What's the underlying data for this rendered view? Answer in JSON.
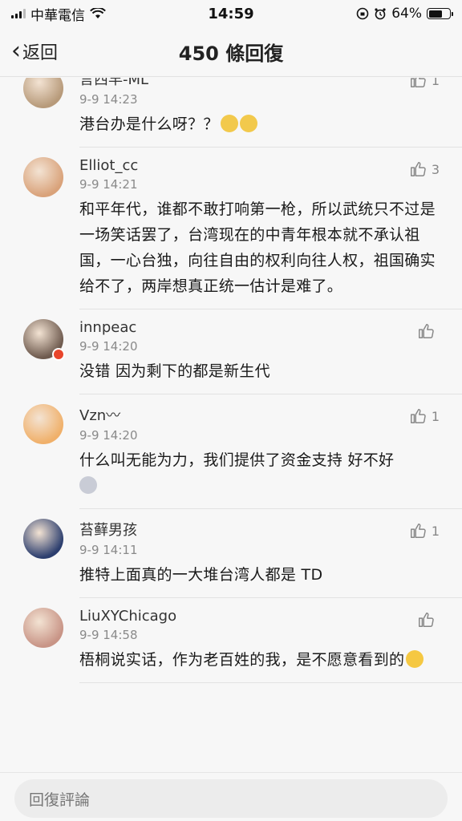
{
  "status_bar": {
    "carrier": "中華電信",
    "time": "14:59",
    "battery": "64%",
    "battery_level": 0.64
  },
  "nav": {
    "back_label": "返回",
    "title": "450 條回復"
  },
  "comments": [
    {
      "name": "言西早-ML",
      "time": "9-9 14:23",
      "text": "港台办是什么呀？？",
      "likes": "1",
      "avatar_color": "#b79a7a",
      "emoji_color": "#f2c94c"
    },
    {
      "name": "Elliot_cc",
      "time": "9-9 14:21",
      "text": "和平年代，谁都不敢打响第一枪，所以武统只不过是一场笑话罢了，台湾现在的中青年根本就不承认祖国，一心台独，向往自由的权利向往人权，祖国确实给不了，两岸想真正统一估计是难了。",
      "likes": "3",
      "avatar_color": "#d9a27a"
    },
    {
      "name": "innpeac",
      "time": "9-9 14:20",
      "text": "没错 因为剩下的都是新生代",
      "likes": "",
      "avatar_color": "#6e5a4e"
    },
    {
      "name": "Vzn〰",
      "time": "9-9 14:20",
      "text": "什么叫无能为力，我们提供了资金支持 好不好",
      "likes": "1",
      "avatar_color": "#f0b06a",
      "emoji_color": "#c9ccd6"
    },
    {
      "name": "苔藓男孩",
      "time": "9-9 14:11",
      "text": "推特上面真的一大堆台湾人都是 TD",
      "likes": "1",
      "avatar_color": "#2c3e6e"
    },
    {
      "name": "LiuXYChicago",
      "time": "9-9 14:58",
      "text": "梧桐说实话，作为老百姓的我，是不愿意看到的",
      "likes": "",
      "avatar_color": "#c89486",
      "emoji_color": "#f5c842"
    }
  ],
  "footer": {
    "reply_placeholder": "回復評論"
  }
}
